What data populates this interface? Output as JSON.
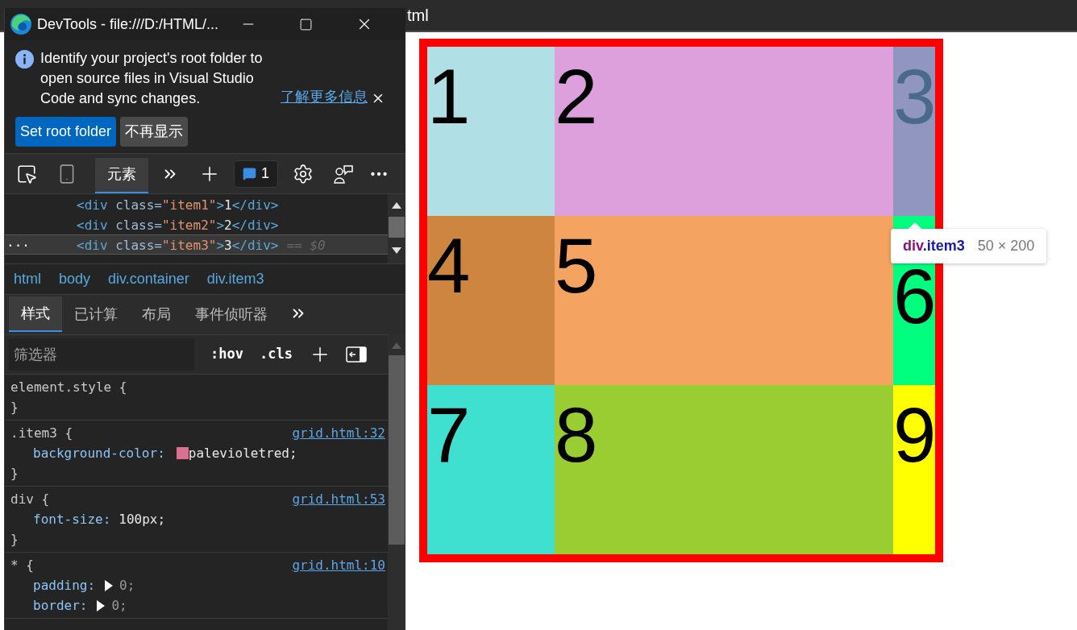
{
  "browser": {
    "address_fragment": "tml"
  },
  "devtools": {
    "title": "DevTools - file:///D:/HTML/...",
    "infobar": {
      "message": "Identify your project's root folder to open source files in Visual Studio Code and sync changes.",
      "link": "了解更多信息",
      "buttons": [
        "Set root folder",
        "不再显示"
      ]
    },
    "toolbar": {
      "tabs": [
        {
          "label": "元素",
          "selected": true
        }
      ],
      "issues_count": "1"
    },
    "dom_lines": [
      {
        "selected": false,
        "tokens": [
          {
            "kind": "tag",
            "text": "<div "
          },
          {
            "kind": "attr",
            "text": "class="
          },
          {
            "kind": "value",
            "text": "\"item1\""
          },
          {
            "kind": "tag",
            "text": ">"
          },
          {
            "kind": "text",
            "text": "1"
          },
          {
            "kind": "tag",
            "text": "</div>"
          }
        ]
      },
      {
        "selected": false,
        "tokens": [
          {
            "kind": "tag",
            "text": "<div "
          },
          {
            "kind": "attr",
            "text": "class="
          },
          {
            "kind": "value",
            "text": "\"item2\""
          },
          {
            "kind": "tag",
            "text": ">"
          },
          {
            "kind": "text",
            "text": "2"
          },
          {
            "kind": "tag",
            "text": "</div>"
          }
        ]
      },
      {
        "selected": true,
        "marker": "···",
        "suffix": "== $0",
        "tokens": [
          {
            "kind": "tag",
            "text": "<div "
          },
          {
            "kind": "attr",
            "text": "class="
          },
          {
            "kind": "value",
            "text": "\"item3\""
          },
          {
            "kind": "tag",
            "text": ">"
          },
          {
            "kind": "text",
            "text": "3"
          },
          {
            "kind": "tag",
            "text": "</div>"
          }
        ]
      }
    ],
    "breadcrumbs": [
      "html",
      "body",
      "div.container",
      "div.item3"
    ],
    "subtabs": [
      {
        "label": "样式",
        "selected": true
      },
      {
        "label": "已计算",
        "selected": false
      },
      {
        "label": "布局",
        "selected": false
      },
      {
        "label": "事件侦听器",
        "selected": false
      }
    ],
    "filter": {
      "placeholder": "筛选器",
      "buttons": [
        ":hov",
        ".cls"
      ]
    },
    "rules": [
      {
        "selector": "element.style {",
        "close": "}"
      },
      {
        "selector": ".item3 {",
        "source": "grid.html:32",
        "close": "}",
        "declarations": [
          {
            "property": "background-color:",
            "value": "palevioletred;",
            "color": "#db7093"
          }
        ]
      },
      {
        "selector": "div {",
        "source": "grid.html:53",
        "close": "}",
        "declarations": [
          {
            "property": "font-size:",
            "value": "100px;"
          }
        ]
      },
      {
        "selector": "* {",
        "source": "grid.html:10",
        "declarations": [
          {
            "property": "padding:",
            "value": "0;",
            "expandable": true
          },
          {
            "property": "border:",
            "value": "0;",
            "expandable": true
          }
        ]
      }
    ]
  },
  "page": {
    "cells": [
      {
        "label": "1",
        "color": "#b0e0e6",
        "highlighted": false
      },
      {
        "label": "2",
        "color": "#dda0dd",
        "highlighted": false
      },
      {
        "label": "3",
        "color": "#9196c0",
        "highlighted": true
      },
      {
        "label": "4",
        "color": "#cd853f",
        "highlighted": false
      },
      {
        "label": "5",
        "color": "#f4a460",
        "highlighted": false
      },
      {
        "label": "6",
        "color": "#00ff7f",
        "highlighted": false
      },
      {
        "label": "7",
        "color": "#40e0d0",
        "highlighted": false
      },
      {
        "label": "8",
        "color": "#9acd32",
        "highlighted": false
      },
      {
        "label": "9",
        "color": "#ffff00",
        "highlighted": false
      }
    ],
    "tooltip": {
      "tag": "div",
      "class": ".item3",
      "size": "50 × 200"
    }
  }
}
